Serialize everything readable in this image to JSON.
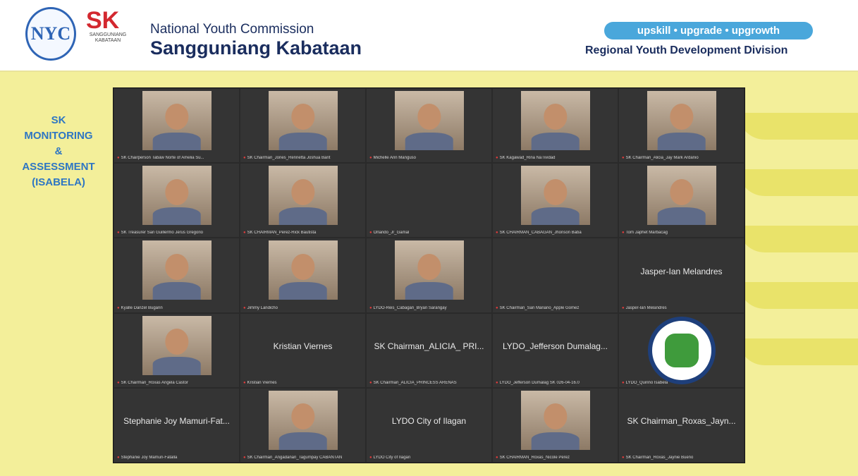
{
  "header": {
    "logo_nyc_text": "NYC",
    "logo_sk_mark": "SK",
    "logo_sk_sub": "SANGGUNIANG KABATAAN",
    "org_name": "National Youth Commission",
    "org_sub": "Sangguniang Kabataan",
    "tagline": "upskill • upgrade • upgrowth",
    "division": "Regional Youth Development Division"
  },
  "caption": [
    "SK",
    "MONITORING",
    "&",
    "ASSESSMENT",
    "(ISABELA)"
  ],
  "colors": {
    "meeting_bg": "#2b2b2b",
    "accent": "#4aa7db",
    "brand_text": "#1a2d5e"
  },
  "participants": [
    {
      "label": "SK Chairperson Tabaw Norte of Amelia Su...",
      "video": true
    },
    {
      "label": "SK Chairman_Jones_Rennetta Joshua Barit",
      "video": true
    },
    {
      "label": "Michelle Ann Manguso",
      "video": true
    },
    {
      "label": "SK Kagawad_Rina NaTividad",
      "video": true
    },
    {
      "label": "SK Chairman_Alicia_Jay Mark Ardanio",
      "video": true
    },
    {
      "label": "SK Treasurer San Guillermo Jerus Gregorio",
      "video": true
    },
    {
      "label": "SK CHAIRMAN_Perez-Rick Bautista",
      "video": true
    },
    {
      "label": "Orlando_Jr_Gamal",
      "video": false,
      "display_name": ""
    },
    {
      "label": "SK CHAIRMAN_CABAGAN_Jhonson Baba",
      "video": true
    },
    {
      "label": "Tom Japhet Marbacag",
      "video": true
    },
    {
      "label": "Kyalle Danzel Bugarin",
      "video": true
    },
    {
      "label": "Jimmy Landicho",
      "video": true
    },
    {
      "label": "LYDO-Reis_Cabagan_Bryan Sarangay",
      "video": true
    },
    {
      "label": "SK Chairman_San Mariano_Apple Gomez",
      "video": false,
      "display_name": ""
    },
    {
      "label": "Jasper-Ian Melandres",
      "video": false,
      "display_name": "Jasper-Ian Melandres"
    },
    {
      "label": "SK Chairman_Roxas Angela Castor",
      "video": true
    },
    {
      "label": "Kristian Viernes",
      "video": false,
      "display_name": "Kristian Viernes"
    },
    {
      "label": "SK Chairman_ALICIA_PRINCESS ARENAS",
      "video": false,
      "display_name": "SK Chairman_ALICIA_ PRI..."
    },
    {
      "label": "LYDO_Jefferson Dumalag SK 026-04-16.0",
      "video": false,
      "display_name": "LYDO_Jefferson Dumalag..."
    },
    {
      "label": "LYDO_Quirino Isabela",
      "video": "emblem"
    },
    {
      "label": "Stephanie Joy Mamuri-Fatalla",
      "video": false,
      "display_name": "Stephanie Joy Mamuri-Fat..."
    },
    {
      "label": "SK Chairman_Angadanan_Tagumpay CABANTAN",
      "video": true
    },
    {
      "label": "LYDO City of Ilagan",
      "video": false,
      "display_name": "LYDO City of Ilagan"
    },
    {
      "label": "SK CHAIRMAN_Roxas_Nicole Perez",
      "video": true
    },
    {
      "label": "SK Chairman_Roxas_Jaynie Bueno",
      "video": false,
      "display_name": "SK Chairman_Roxas_Jayn..."
    }
  ]
}
